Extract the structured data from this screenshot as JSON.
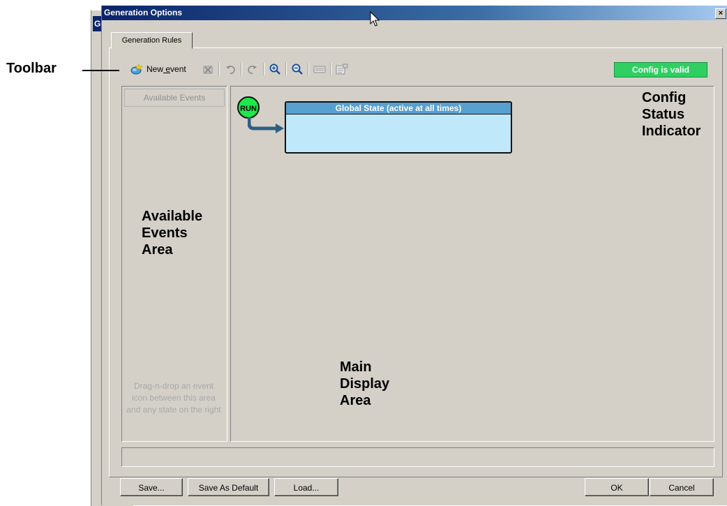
{
  "background_window": {
    "title": "G"
  },
  "window": {
    "title": "Generation Options",
    "close_glyph": "×"
  },
  "tabs": [
    {
      "label": "Generation Rules"
    }
  ],
  "toolbar": {
    "new_event_prefix": "New",
    "new_event_underlined": " e",
    "new_event_suffix": "vent",
    "icons": [
      "new-event-icon",
      "delete-icon",
      "undo-icon",
      "redo-icon",
      "zoom-in-icon",
      "zoom-out-icon",
      "keyboard-icon",
      "properties-icon"
    ]
  },
  "status": {
    "text": "Config is valid",
    "color": "#2fcf62"
  },
  "events_area": {
    "header": "Available Events",
    "hint": "Drag-n-drop an event icon between this area and any state on the right"
  },
  "diagram": {
    "run_label": "RUN",
    "state_title": "Global State (active at all times)"
  },
  "buttons": {
    "save": "Save...",
    "save_default": "Save As Default",
    "load": "Load...",
    "ok": "OK",
    "cancel": "Cancel"
  },
  "annotations": {
    "toolbar": "Toolbar",
    "config_status": [
      "Config",
      "Status",
      "Indicator"
    ],
    "events_area": [
      "Available",
      "Events",
      "Area"
    ],
    "main_area": [
      "Main",
      "Display",
      "Area"
    ]
  }
}
